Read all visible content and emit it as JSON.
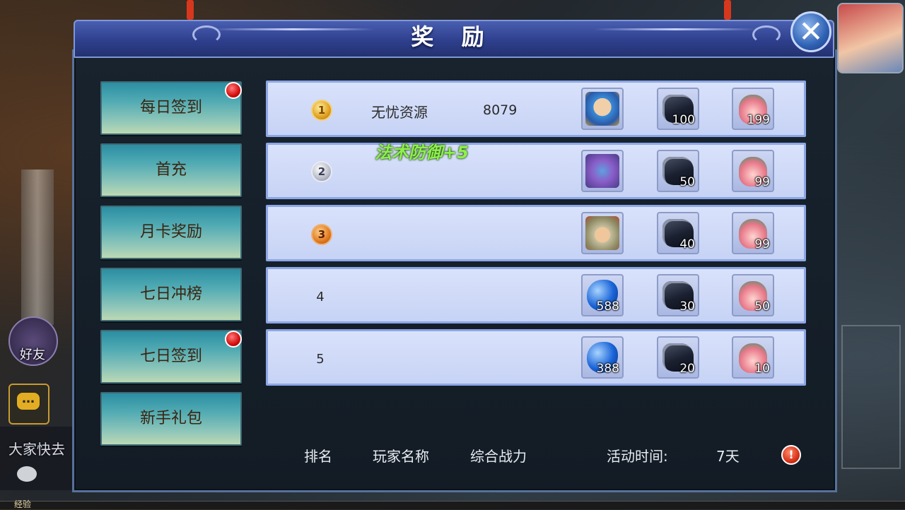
{
  "window": {
    "title": "奖 励"
  },
  "hud": {
    "friend_label": "好友",
    "chat_preview": "大家快去",
    "exp_label": "经验"
  },
  "tabs": [
    {
      "label": "每日签到",
      "has_dot": true
    },
    {
      "label": "首充",
      "has_dot": false
    },
    {
      "label": "月卡奖励",
      "has_dot": false
    },
    {
      "label": "七日冲榜",
      "has_dot": false
    },
    {
      "label": "七日签到",
      "has_dot": true
    },
    {
      "label": "新手礼包",
      "has_dot": false
    }
  ],
  "rows": [
    {
      "rank": "1",
      "medal": "gold",
      "player_name": "无忧资源",
      "power": "8079",
      "items": [
        {
          "icon": "hero-portrait-icon",
          "count": ""
        },
        {
          "icon": "black-stone-icon",
          "count": "100"
        },
        {
          "icon": "gift-bag-icon",
          "count": "199"
        }
      ]
    },
    {
      "rank": "2",
      "medal": "silver",
      "player_name": "",
      "power": "",
      "items": [
        {
          "icon": "hero-portrait-icon",
          "count": ""
        },
        {
          "icon": "black-stone-icon",
          "count": "50"
        },
        {
          "icon": "gift-bag-icon",
          "count": "99"
        }
      ]
    },
    {
      "rank": "3",
      "medal": "bronze",
      "player_name": "",
      "power": "",
      "items": [
        {
          "icon": "hero-portrait-icon",
          "count": ""
        },
        {
          "icon": "black-stone-icon",
          "count": "40"
        },
        {
          "icon": "gift-bag-icon",
          "count": "99"
        }
      ]
    },
    {
      "rank": "4",
      "medal": "none",
      "player_name": "",
      "power": "",
      "items": [
        {
          "icon": "blue-orb-icon",
          "count": "588"
        },
        {
          "icon": "black-stone-icon",
          "count": "30"
        },
        {
          "icon": "gift-bag-icon",
          "count": "50"
        }
      ]
    },
    {
      "rank": "5",
      "medal": "none",
      "player_name": "",
      "power": "",
      "items": [
        {
          "icon": "blue-orb-icon",
          "count": "388"
        },
        {
          "icon": "black-stone-icon",
          "count": "20"
        },
        {
          "icon": "gift-bag-icon",
          "count": "10"
        }
      ]
    }
  ],
  "floating_buff": "法术防御+5",
  "footer": {
    "col_rank": "排名",
    "col_player": "玩家名称",
    "col_power": "综合战力",
    "activity_label": "活动时间:",
    "activity_value": "7天",
    "info_icon": "!"
  },
  "colors": {
    "title_bar": "#2e3f8d",
    "row_bg": "#d9e2fb",
    "tab_bg": "#8fc6b9",
    "buff_green": "#8ff04a",
    "red_dot": "#d40e0e"
  }
}
